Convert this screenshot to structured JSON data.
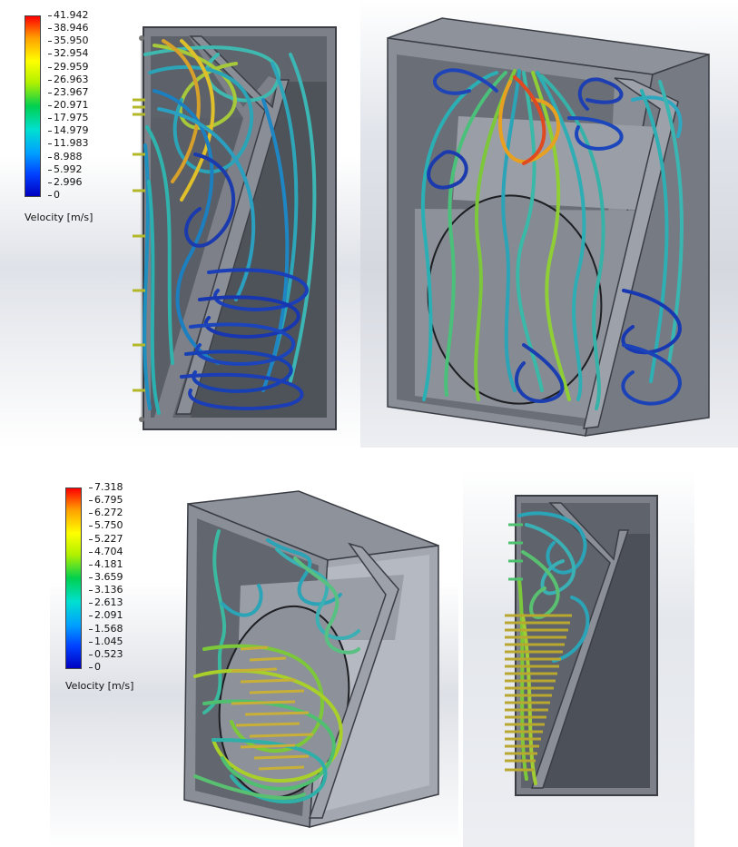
{
  "legend_top": {
    "ticks": [
      "41.942",
      "38.946",
      "35.950",
      "32.954",
      "29.959",
      "26.963",
      "23.967",
      "20.971",
      "17.975",
      "14.979",
      "11.983",
      "8.988",
      "5.992",
      "2.996",
      "0"
    ],
    "title": "Velocity [m/s]"
  },
  "legend_bottom": {
    "ticks": [
      "7.318",
      "6.795",
      "6.272",
      "5.750",
      "5.227",
      "4.704",
      "4.181",
      "3.659",
      "3.136",
      "2.613",
      "2.091",
      "1.568",
      "1.045",
      "0.523",
      "0"
    ],
    "title": "Velocity [m/s]"
  },
  "colors": {
    "housing_wall": "#7d8088",
    "housing_dark": "#4f535b",
    "housing_light": "#a3a7b0",
    "cavity_back": "#60646c",
    "diaphragm": "#8f939c"
  }
}
